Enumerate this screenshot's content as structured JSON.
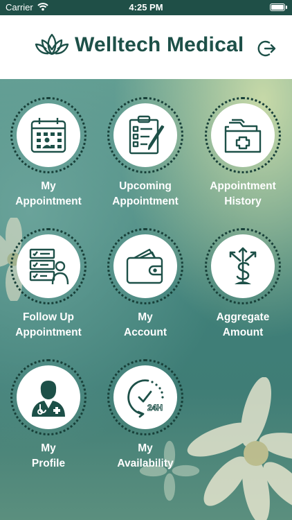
{
  "status_bar": {
    "carrier": "Carrier",
    "time": "4:25 PM"
  },
  "header": {
    "title": "Welltech Medical",
    "logo_icon": "lotus-icon",
    "logout_icon": "logout-icon"
  },
  "colors": {
    "primary": "#1d5048",
    "status_bar_bg": "#1f4f47",
    "ring": "#173f38",
    "label_text": "#ffffff"
  },
  "tiles": [
    {
      "icon": "calendar-icon",
      "line1": "My",
      "line2": "Appointment"
    },
    {
      "icon": "clipboard-checklist-icon",
      "line1": "Upcoming",
      "line2": "Appointment"
    },
    {
      "icon": "medical-folder-icon",
      "line1": "Appointment",
      "line2": "History"
    },
    {
      "icon": "patient-list-icon",
      "line1": "Follow Up",
      "line2": "Appointment"
    },
    {
      "icon": "wallet-icon",
      "line1": "My",
      "line2": "Account"
    },
    {
      "icon": "dollar-growth-icon",
      "line1": "Aggregate",
      "line2": "Amount"
    },
    {
      "icon": "doctor-icon",
      "line1": "My",
      "line2": "Profile"
    },
    {
      "icon": "clock-24h-icon",
      "line1": "My",
      "line2": "Availability"
    }
  ]
}
